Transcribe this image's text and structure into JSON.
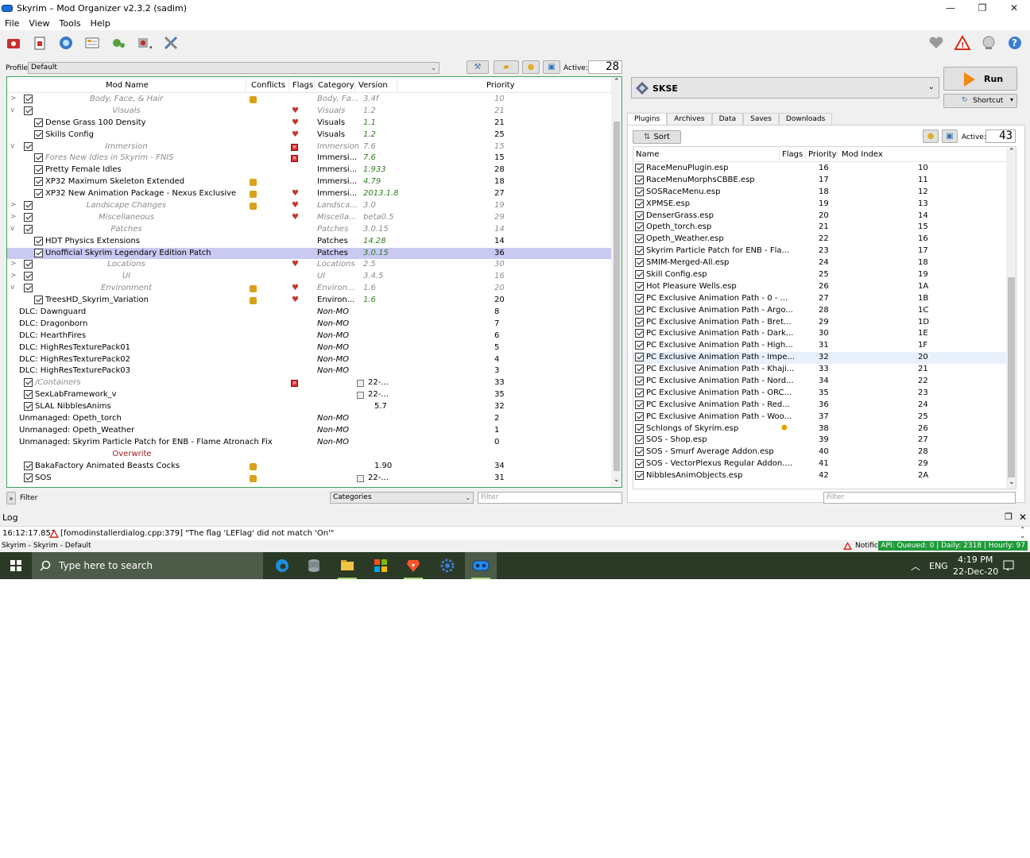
{
  "window": {
    "title": "Skyrim – Mod Organizer v2.3.2 (sadim)",
    "min": "—",
    "max": "❐",
    "close": "✕"
  },
  "menu": [
    "File",
    "View",
    "Tools",
    "Help"
  ],
  "toolbar_icons": [
    "instances-icon",
    "profiles-icon",
    "nexus-icon",
    "ini-editor-icon",
    "tools-icon",
    "executables-icon",
    "settings-icon",
    "endorse-icon",
    "notifications-icon",
    "update-icon",
    "help-icon"
  ],
  "profile": {
    "label": "Profile",
    "value": "Default",
    "active_label": "Active:",
    "active_count": "28"
  },
  "modlist": {
    "columns": [
      "Mod Name",
      "Conflicts",
      "Flags",
      "Category",
      "Version",
      "Priority"
    ],
    "rows": [
      {
        "exp": ">",
        "cb": true,
        "name": "Body, Face, & Hair",
        "kind": "sep",
        "conf": "yellow",
        "flag": "",
        "cat": "Body, Fa...",
        "ver": "3.4f",
        "verStyle": "gray",
        "pri": "10"
      },
      {
        "exp": "v",
        "cb": true,
        "name": "Visuals",
        "kind": "sep",
        "conf": "",
        "flag": "heart",
        "cat": "Visuals",
        "ver": "1.2",
        "verStyle": "gray",
        "pri": "21"
      },
      {
        "exp": "",
        "cb": true,
        "name": "Dense Grass 100 Density",
        "kind": "child",
        "conf": "",
        "flag": "heart",
        "cat": "Visuals",
        "ver": "1.1",
        "verStyle": "green",
        "pri": "21"
      },
      {
        "exp": "",
        "cb": true,
        "name": "Skills Config",
        "kind": "child",
        "conf": "",
        "flag": "heart",
        "cat": "Visuals",
        "ver": "1.2",
        "verStyle": "green",
        "pri": "25"
      },
      {
        "exp": "v",
        "cb": true,
        "name": "Immersion",
        "kind": "sep",
        "conf": "",
        "flag": "red",
        "cat": "Immersion",
        "ver": "7.6",
        "verStyle": "gray",
        "pri": "15"
      },
      {
        "exp": "",
        "cb": true,
        "name": "Fores New Idles in Skyrim - FNIS",
        "kind": "childgray",
        "conf": "",
        "flag": "red",
        "cat": "Immersi...",
        "ver": "7.6",
        "verStyle": "green",
        "pri": "15"
      },
      {
        "exp": "",
        "cb": true,
        "name": "Pretty Female Idles",
        "kind": "child",
        "conf": "",
        "flag": "",
        "cat": "Immersi...",
        "ver": "1.933",
        "verStyle": "green",
        "pri": "28"
      },
      {
        "exp": "",
        "cb": true,
        "name": "XP32 Maximum Skeleton Extended",
        "kind": "child",
        "conf": "yellow",
        "flag": "",
        "cat": "Immersi...",
        "ver": "4.79",
        "verStyle": "green",
        "pri": "18"
      },
      {
        "exp": "",
        "cb": true,
        "name": "XP32 New Animation Package - Nexus Exclusive",
        "kind": "child",
        "conf": "yellow",
        "flag": "heart",
        "cat": "Immersi...",
        "ver": "2013.1.8",
        "verStyle": "green",
        "pri": "27"
      },
      {
        "exp": ">",
        "cb": true,
        "name": "Landscape Changes",
        "kind": "sep",
        "conf": "yellow",
        "flag": "heart",
        "cat": "Landsca...",
        "ver": "3.0",
        "verStyle": "gray",
        "pri": "19"
      },
      {
        "exp": ">",
        "cb": true,
        "name": "Miscellaneous",
        "kind": "sep",
        "conf": "",
        "flag": "heart",
        "cat": "Miscella...",
        "ver": "beta0.5",
        "verStyle": "gray",
        "pri": "29"
      },
      {
        "exp": "v",
        "cb": true,
        "name": "Patches",
        "kind": "sep",
        "conf": "",
        "flag": "",
        "cat": "Patches",
        "ver": "3.0.15",
        "verStyle": "gray",
        "pri": "14"
      },
      {
        "exp": "",
        "cb": true,
        "name": "HDT Physics Extensions",
        "kind": "child",
        "conf": "",
        "flag": "",
        "cat": "Patches",
        "ver": "14.28",
        "verStyle": "green",
        "pri": "14"
      },
      {
        "exp": "",
        "cb": true,
        "name": "Unofficial Skyrim Legendary Edition Patch",
        "kind": "child",
        "conf": "",
        "flag": "",
        "cat": "Patches",
        "ver": "3.0.15",
        "verStyle": "green",
        "pri": "36",
        "selected": true
      },
      {
        "exp": ">",
        "cb": true,
        "name": "Locations",
        "kind": "sep",
        "conf": "",
        "flag": "heart",
        "cat": "Locations",
        "ver": "2.5",
        "verStyle": "gray",
        "pri": "30"
      },
      {
        "exp": ">",
        "cb": true,
        "name": "UI",
        "kind": "sep",
        "conf": "",
        "flag": "",
        "cat": "UI",
        "ver": "3.4.5",
        "verStyle": "gray",
        "pri": "16"
      },
      {
        "exp": "v",
        "cb": true,
        "name": "Environment",
        "kind": "sep",
        "conf": "yellow",
        "flag": "heart",
        "cat": "Environ...",
        "ver": "1.6",
        "verStyle": "gray",
        "pri": "20"
      },
      {
        "exp": "",
        "cb": true,
        "name": "TreesHD_Skyrim_Variation",
        "kind": "child",
        "conf": "yellow",
        "flag": "heart",
        "cat": "Environ...",
        "ver": "1.6",
        "verStyle": "green",
        "pri": "20"
      },
      {
        "exp": "",
        "cb": false,
        "name": "DLC: Dawnguard",
        "kind": "plain",
        "conf": "",
        "flag": "",
        "cat": "Non-MO",
        "ver": "",
        "verStyle": "",
        "pri": "8"
      },
      {
        "exp": "",
        "cb": false,
        "name": "DLC: Dragonborn",
        "kind": "plain",
        "conf": "",
        "flag": "",
        "cat": "Non-MO",
        "ver": "",
        "verStyle": "",
        "pri": "7"
      },
      {
        "exp": "",
        "cb": false,
        "name": "DLC: HearthFires",
        "kind": "plain",
        "conf": "",
        "flag": "",
        "cat": "Non-MO",
        "ver": "",
        "verStyle": "",
        "pri": "6"
      },
      {
        "exp": "",
        "cb": false,
        "name": "DLC: HighResTexturePack01",
        "kind": "plain",
        "conf": "",
        "flag": "",
        "cat": "Non-MO",
        "ver": "",
        "verStyle": "",
        "pri": "5"
      },
      {
        "exp": "",
        "cb": false,
        "name": "DLC: HighResTexturePack02",
        "kind": "plain",
        "conf": "",
        "flag": "",
        "cat": "Non-MO",
        "ver": "",
        "verStyle": "",
        "pri": "4"
      },
      {
        "exp": "",
        "cb": false,
        "name": "DLC: HighResTexturePack03",
        "kind": "plain",
        "conf": "",
        "flag": "",
        "cat": "Non-MO",
        "ver": "",
        "verStyle": "",
        "pri": "3"
      },
      {
        "exp": "",
        "cb": true,
        "name": "/Containers",
        "kind": "toplevelgray",
        "conf": "",
        "flag": "red",
        "cat": "",
        "ver": "22-...",
        "verStyle": "icon",
        "pri": "33"
      },
      {
        "exp": "",
        "cb": true,
        "name": "SexLabFramework_v",
        "kind": "toplevel",
        "conf": "",
        "flag": "",
        "cat": "",
        "ver": "22-...",
        "verStyle": "icon",
        "pri": "35"
      },
      {
        "exp": "",
        "cb": true,
        "name": "SLAL NibblesAnims",
        "kind": "toplevel",
        "conf": "",
        "flag": "",
        "cat": "",
        "ver": "5.7",
        "verStyle": "plain",
        "pri": "32"
      },
      {
        "exp": "",
        "cb": false,
        "name": "Unmanaged: Opeth_torch",
        "kind": "plain",
        "conf": "",
        "flag": "",
        "cat": "Non-MO",
        "ver": "",
        "verStyle": "",
        "pri": "2"
      },
      {
        "exp": "",
        "cb": false,
        "name": "Unmanaged: Opeth_Weather",
        "kind": "plain",
        "conf": "",
        "flag": "",
        "cat": "Non-MO",
        "ver": "",
        "verStyle": "",
        "pri": "1"
      },
      {
        "exp": "",
        "cb": false,
        "name": "Unmanaged: Skyrim Particle Patch for ENB - Flame Atronach Fix",
        "kind": "plain",
        "conf": "",
        "flag": "",
        "cat": "Non-MO",
        "ver": "",
        "verStyle": "",
        "pri": "0"
      },
      {
        "exp": "",
        "cb": false,
        "name": "Overwrite",
        "kind": "overwrite",
        "conf": "",
        "flag": "",
        "cat": "",
        "ver": "",
        "verStyle": "",
        "pri": ""
      },
      {
        "exp": "",
        "cb": true,
        "name": "BakaFactory Animated Beasts Cocks",
        "kind": "toplevel",
        "conf": "yellow",
        "flag": "",
        "cat": "",
        "ver": "1.90",
        "verStyle": "plain",
        "pri": "34"
      },
      {
        "exp": "",
        "cb": true,
        "name": "SOS",
        "kind": "toplevel",
        "conf": "yellow",
        "flag": "",
        "cat": "",
        "ver": "22-...",
        "verStyle": "icon",
        "pri": "31"
      }
    ]
  },
  "filter": {
    "label": "Filter",
    "categories": "Categories",
    "placeholder": "Filter"
  },
  "executable": {
    "name": "SKSE",
    "run": "Run",
    "shortcut": "Shortcut"
  },
  "tabs": [
    "Plugins",
    "Archives",
    "Data",
    "Saves",
    "Downloads"
  ],
  "plugins": {
    "sort_label": "Sort",
    "active_label": "Active:",
    "active_count": "43",
    "columns": [
      "Name",
      "Flags",
      "Priority",
      "Mod Index"
    ],
    "rows": [
      {
        "name": "RaceMenuPlugin.esp",
        "flag": "",
        "pri": "16",
        "idx": "10"
      },
      {
        "name": "RaceMenuMorphsCBBE.esp",
        "flag": "",
        "pri": "17",
        "idx": "11"
      },
      {
        "name": "SOSRaceMenu.esp",
        "flag": "",
        "pri": "18",
        "idx": "12"
      },
      {
        "name": "XPMSE.esp",
        "flag": "",
        "pri": "19",
        "idx": "13"
      },
      {
        "name": "DenserGrass.esp",
        "flag": "",
        "pri": "20",
        "idx": "14"
      },
      {
        "name": "Opeth_torch.esp",
        "flag": "",
        "pri": "21",
        "idx": "15"
      },
      {
        "name": "Opeth_Weather.esp",
        "flag": "",
        "pri": "22",
        "idx": "16"
      },
      {
        "name": "Skyrim Particle Patch for ENB - Fla...",
        "flag": "",
        "pri": "23",
        "idx": "17"
      },
      {
        "name": "SMIM-Merged-All.esp",
        "flag": "",
        "pri": "24",
        "idx": "18"
      },
      {
        "name": "Skill Config.esp",
        "flag": "",
        "pri": "25",
        "idx": "19"
      },
      {
        "name": "Hot Pleasure Wells.esp",
        "flag": "",
        "pri": "26",
        "idx": "1A"
      },
      {
        "name": "PC Exclusive Animation Path - 0 - ...",
        "flag": "",
        "pri": "27",
        "idx": "1B"
      },
      {
        "name": "PC Exclusive Animation Path - Argo...",
        "flag": "",
        "pri": "28",
        "idx": "1C"
      },
      {
        "name": "PC Exclusive Animation Path - Bret...",
        "flag": "",
        "pri": "29",
        "idx": "1D"
      },
      {
        "name": "PC Exclusive Animation Path - Dark...",
        "flag": "",
        "pri": "30",
        "idx": "1E"
      },
      {
        "name": "PC Exclusive Animation Path - High...",
        "flag": "",
        "pri": "31",
        "idx": "1F"
      },
      {
        "name": "PC Exclusive Animation Path - Impe...",
        "flag": "",
        "pri": "32",
        "idx": "20",
        "sel": true
      },
      {
        "name": "PC Exclusive Animation Path - Khaji...",
        "flag": "",
        "pri": "33",
        "idx": "21"
      },
      {
        "name": "PC Exclusive Animation Path - Nord...",
        "flag": "",
        "pri": "34",
        "idx": "22"
      },
      {
        "name": "PC Exclusive Animation Path - ORC...",
        "flag": "",
        "pri": "35",
        "idx": "23"
      },
      {
        "name": "PC Exclusive Animation Path - Red...",
        "flag": "",
        "pri": "36",
        "idx": "24"
      },
      {
        "name": "PC Exclusive Animation Path - Woo...",
        "flag": "",
        "pri": "37",
        "idx": "25"
      },
      {
        "name": "Schlongs of Skyrim.esp",
        "flag": "cube",
        "pri": "38",
        "idx": "26"
      },
      {
        "name": "SOS - Shop.esp",
        "flag": "",
        "pri": "39",
        "idx": "27"
      },
      {
        "name": "SOS - Smurf Average Addon.esp",
        "flag": "",
        "pri": "40",
        "idx": "28"
      },
      {
        "name": "SOS - VectorPlexus Regular Addon....",
        "flag": "",
        "pri": "41",
        "idx": "29"
      },
      {
        "name": "NibblesAnimObjects.esp",
        "flag": "",
        "pri": "42",
        "idx": "2A"
      }
    ],
    "filter_placeholder": "Filter"
  },
  "log": {
    "title": "Log",
    "time": "16:12:17.851",
    "message": "[fomodinstallerdialog.cpp:379] \"The flag 'LEFlag' did not match 'On'\""
  },
  "status": {
    "left": "Skyrim - Skyrim - Default",
    "notifications": "Notifications",
    "api": "API: Queued: 0 | Daily: 2318 | Hourly: 97"
  },
  "taskbar": {
    "search": "Type here to search",
    "lang": "ENG",
    "time": "4:19 PM",
    "date": "22-Dec-20"
  }
}
